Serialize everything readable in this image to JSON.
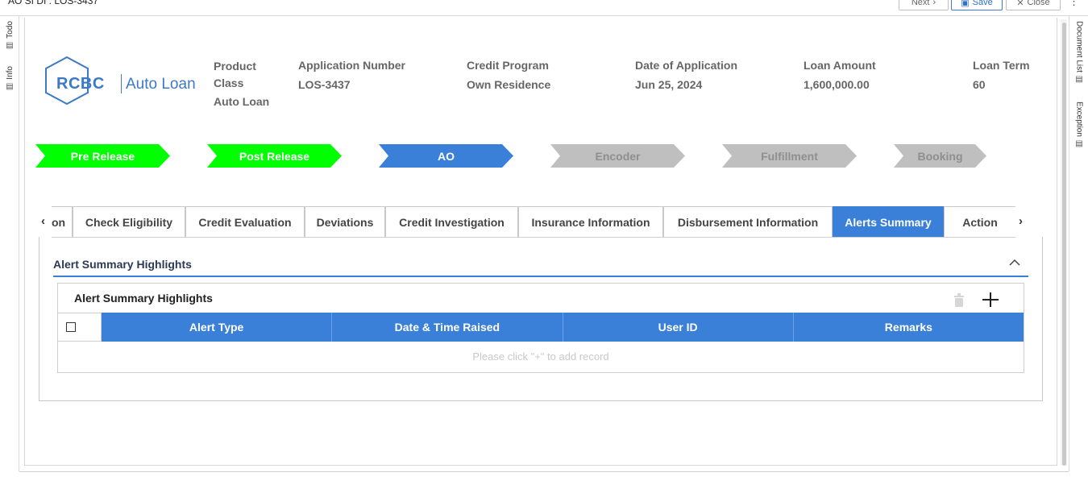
{
  "window": {
    "title": "AO SI DI : LOS-3437",
    "next_label": "Next",
    "save_label": "Save",
    "close_label": "Close"
  },
  "left_rail": [
    "Todo",
    "Info"
  ],
  "right_rail": [
    "Document List",
    "Exception"
  ],
  "logo": {
    "brand": "RCBC",
    "product": "Auto Loan"
  },
  "header": {
    "product_class": {
      "label": "Product Class",
      "value": "Auto Loan"
    },
    "application_number": {
      "label": "Application Number",
      "value": "LOS-3437"
    },
    "credit_program": {
      "label": "Credit Program",
      "value": "Own Residence"
    },
    "date_of_application": {
      "label": "Date of Application",
      "value": "Jun 25, 2024"
    },
    "loan_amount": {
      "label": "Loan Amount",
      "value": "1,600,000.00"
    },
    "loan_term": {
      "label": "Loan Term",
      "value": "60"
    }
  },
  "stages": [
    {
      "label": "Pre Release",
      "status": "done"
    },
    {
      "label": "Post Release",
      "status": "done"
    },
    {
      "label": "AO",
      "status": "current"
    },
    {
      "label": "Encoder",
      "status": "todo"
    },
    {
      "label": "Fulfillment",
      "status": "todo"
    },
    {
      "label": "Booking",
      "status": "todo"
    }
  ],
  "tabs": [
    {
      "label": "on"
    },
    {
      "label": "Check Eligibility"
    },
    {
      "label": "Credit Evaluation"
    },
    {
      "label": "Deviations"
    },
    {
      "label": "Credit Investigation"
    },
    {
      "label": "Insurance Information"
    },
    {
      "label": "Disbursement Information"
    },
    {
      "label": "Alerts Summary",
      "active": true
    },
    {
      "label": "Action"
    }
  ],
  "section": {
    "title": "Alert Summary Highlights"
  },
  "grid": {
    "title": "Alert Summary Highlights",
    "columns": [
      "Alert Type",
      "Date & Time Raised",
      "User ID",
      "Remarks"
    ],
    "empty_message": "Please click \"+\" to add record"
  },
  "colors": {
    "accent": "#3a80d8",
    "done_stage": "#00ff00",
    "todo_stage": "#bfbfbf"
  }
}
